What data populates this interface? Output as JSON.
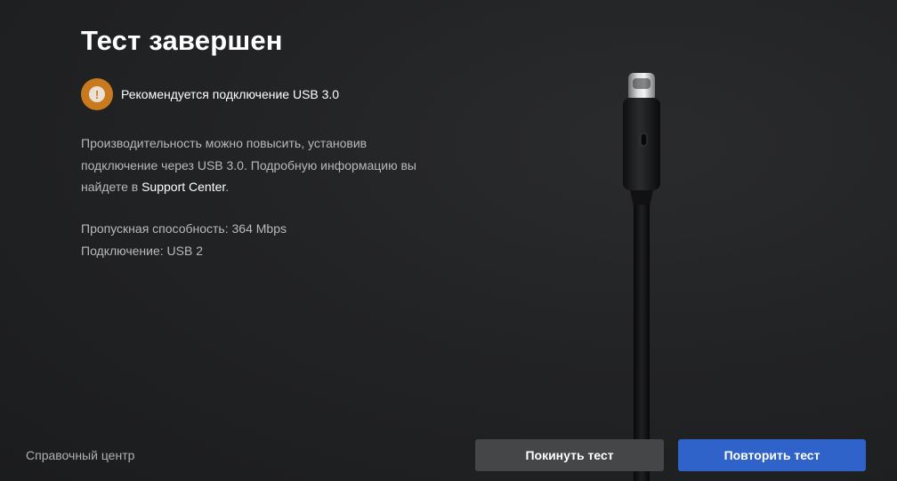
{
  "page": {
    "title": "Тест завершен"
  },
  "warning": {
    "icon": "exclamation-icon",
    "icon_color": "#c97a1e",
    "icon_symbol": "!",
    "text": "Рекомендуется подключение USB 3.0"
  },
  "description": {
    "text_before_link": "Производительность можно повысить, установив подключение через USB 3.0. Подробную информацию вы найдете в ",
    "link_text": "Support Center",
    "text_after_link": "."
  },
  "stats": {
    "bandwidth": "Пропускная способность: 364 Mbps",
    "connection": "Подключение: USB 2"
  },
  "footer": {
    "help_link": "Справочный центр",
    "leave_button": "Покинуть тест",
    "retry_button": "Повторить тест"
  },
  "colors": {
    "background": "#1d1e20",
    "accent_blue": "#2f63c9",
    "secondary_button": "#454648",
    "warning_orange": "#c97a1e"
  }
}
